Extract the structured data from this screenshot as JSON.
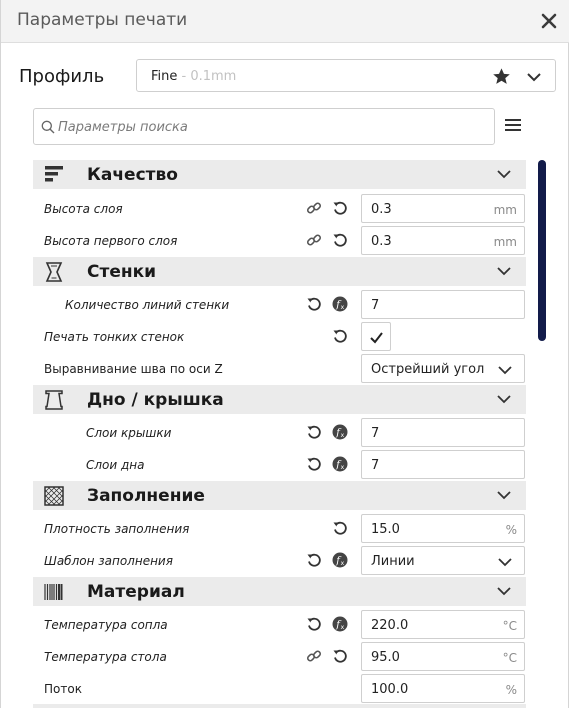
{
  "window": {
    "title": "Параметры печати"
  },
  "profile": {
    "label": "Профиль",
    "name": "Fine",
    "sub": " - 0.1mm"
  },
  "search": {
    "placeholder": "Параметры поиска"
  },
  "categories": {
    "quality": {
      "label": "Качество",
      "icon": "quality-icon"
    },
    "walls": {
      "label": "Стенки",
      "icon": "walls-icon"
    },
    "topbottom": {
      "label": "Дно / крышка",
      "icon": "top-bottom-icon"
    },
    "infill": {
      "label": "Заполнение",
      "icon": "infill-icon"
    },
    "material": {
      "label": "Материал",
      "icon": "material-icon"
    }
  },
  "settings": {
    "layer_height": {
      "label": "Высота слоя",
      "value": "0.3",
      "unit": "mm"
    },
    "initial_layer_height": {
      "label": "Высота первого слоя",
      "value": "0.3",
      "unit": "mm"
    },
    "wall_line_count": {
      "label": "Количество линий стенки",
      "value": "7"
    },
    "thin_walls": {
      "label": "Печать тонких стенок",
      "checked": true
    },
    "z_seam": {
      "label": "Выравнивание шва по оси Z",
      "value": "Острейший угол"
    },
    "top_layers": {
      "label": "Слои крышки",
      "value": "7"
    },
    "bottom_layers": {
      "label": "Слои дна",
      "value": "7"
    },
    "infill_density": {
      "label": "Плотность заполнения",
      "value": "15.0",
      "unit": "%"
    },
    "infill_pattern": {
      "label": "Шаблон заполнения",
      "value": "Линии"
    },
    "nozzle_temp": {
      "label": "Температура сопла",
      "value": "220.0",
      "unit": "°C"
    },
    "bed_temp": {
      "label": "Температура стола",
      "value": "95.0",
      "unit": "°C"
    },
    "flow": {
      "label": "Поток",
      "value": "100.0",
      "unit": "%"
    }
  },
  "colors": {
    "scrollbar": "#121b4a",
    "category_bg": "#ebebeb",
    "header_bg": "#f3f3f3"
  }
}
